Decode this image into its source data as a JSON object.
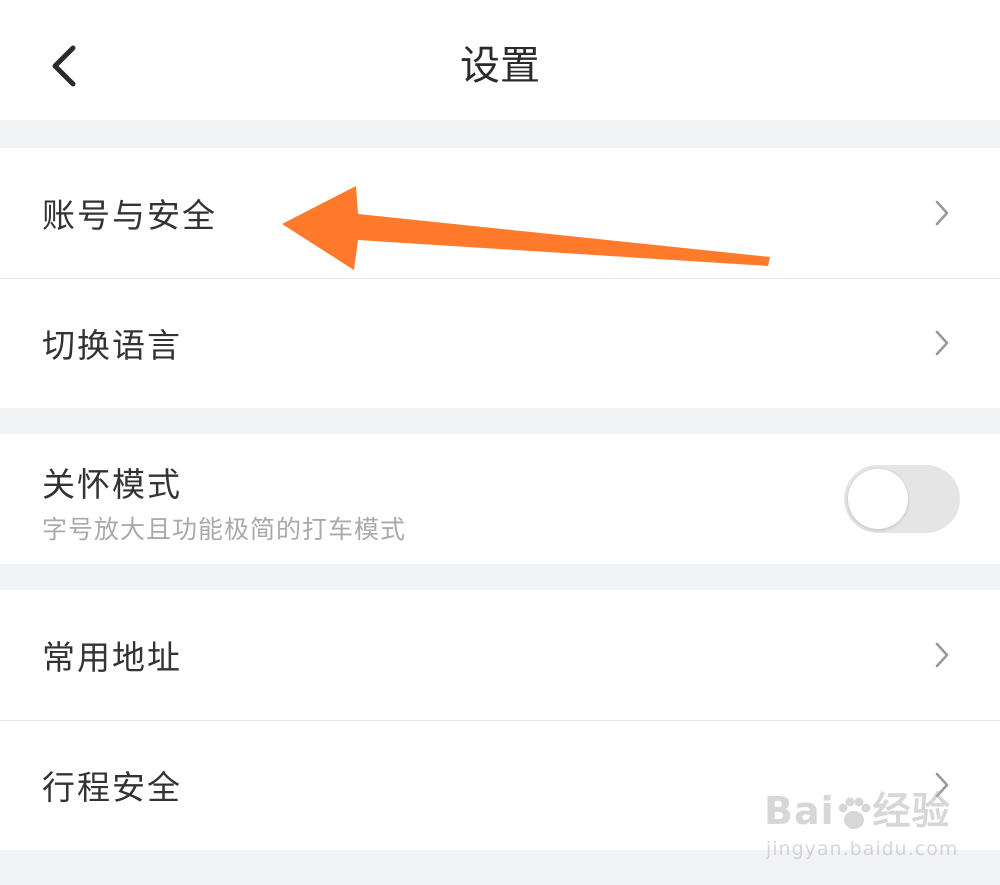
{
  "header": {
    "title": "设置",
    "back_icon": "chevron-left-icon"
  },
  "groups": [
    {
      "rows": [
        {
          "label": "账号与安全",
          "icon": "chevron-right-icon"
        },
        {
          "label": "切换语言",
          "icon": "chevron-right-icon"
        }
      ]
    },
    {
      "toggle": {
        "title": "关怀模式",
        "subtitle": "字号放大且功能极简的打车模式",
        "enabled": false
      }
    },
    {
      "rows": [
        {
          "label": "常用地址",
          "icon": "chevron-right-icon"
        },
        {
          "label": "行程安全",
          "icon": "chevron-right-icon"
        }
      ]
    }
  ],
  "annotation": {
    "arrow_color": "#ff7a2b",
    "arrow_points_to": "账号与安全"
  },
  "watermark": {
    "brand_prefix": "Bai",
    "brand_suffix": "经验",
    "url": "jingyan.baidu.com"
  }
}
